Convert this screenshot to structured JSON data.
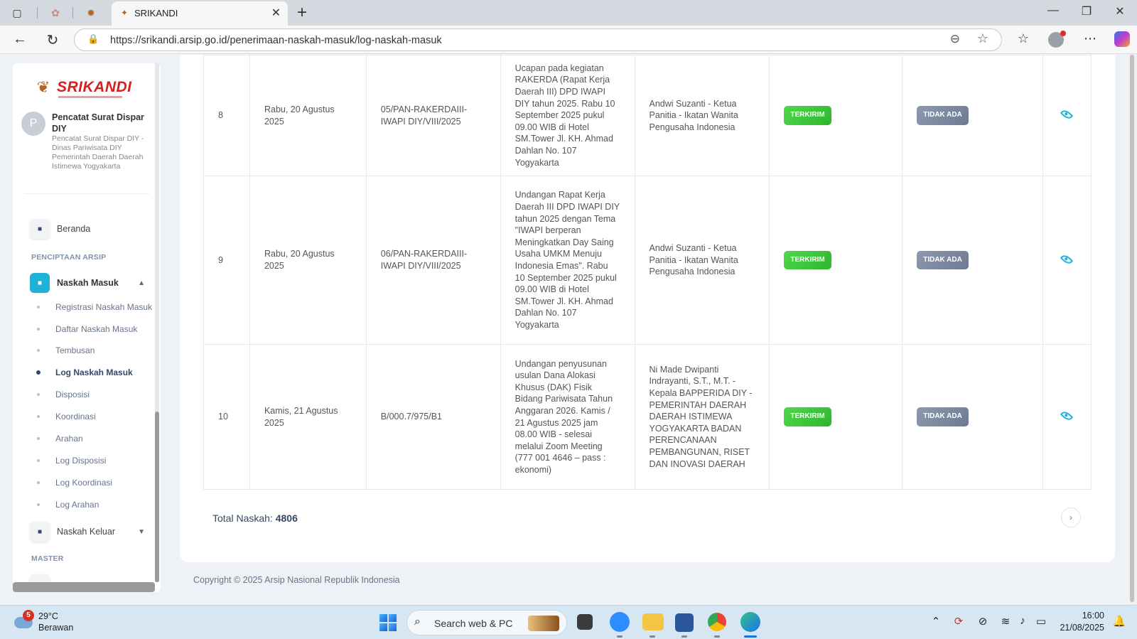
{
  "browser": {
    "tab_title": "SRIKANDI",
    "url": "https://srikandi.arsip.go.id/penerimaan-naskah-masuk/log-naskah-masuk"
  },
  "sidebar": {
    "brand": "SRIKANDI",
    "user": {
      "initial": "P",
      "name": "Pencatat Surat Dispar DIY",
      "description": "Pencatat Surat Dispar DIY - Dinas Pariwisata DIY Pemerintah Daerah Daerah Istimewa Yogyakarta"
    },
    "home": "Beranda",
    "section_penciptaan": "PENCIPTAAN ARSIP",
    "naskah_masuk": "Naskah Masuk",
    "submenu": [
      {
        "label": "Registrasi Naskah Masuk"
      },
      {
        "label": "Daftar Naskah Masuk"
      },
      {
        "label": "Tembusan"
      },
      {
        "label": "Log Naskah Masuk"
      },
      {
        "label": "Disposisi"
      },
      {
        "label": "Koordinasi"
      },
      {
        "label": "Arahan"
      },
      {
        "label": "Log Disposisi"
      },
      {
        "label": "Log Koordinasi"
      },
      {
        "label": "Log Arahan"
      }
    ],
    "naskah_keluar": "Naskah Keluar",
    "section_master": "MASTER"
  },
  "table": {
    "rows": [
      {
        "no": "8",
        "date": "Rabu, 20 Agustus 2025",
        "number": "05/PAN-RAKERDAIII-IWAPI DIY/VIII/2025",
        "subject": "Ucapan pada kegiatan RAKERDA (Rapat Kerja Daerah III) DPD IWAPI DIY tahun 2025. Rabu 10 September 2025 pukul 09.00 WIB di Hotel SM.Tower Jl. KH. Ahmad Dahlan No. 107 Yogyakarta",
        "from": "Andwi Suzanti - Ketua Panitia - Ikatan Wanita Pengusaha Indonesia",
        "status": "TERKIRIM",
        "disposisi": "TIDAK ADA"
      },
      {
        "no": "9",
        "date": "Rabu, 20 Agustus 2025",
        "number": "06/PAN-RAKERDAIII-IWAPI DIY/VIII/2025",
        "subject": "Undangan Rapat Kerja Daerah III DPD IWAPI DIY tahun 2025 dengan Tema \"IWAPI berperan Meningkatkan Day Saing Usaha UMKM Menuju Indonesia Emas\". Rabu 10 September 2025 pukul 09.00 WIB di Hotel SM.Tower Jl. KH. Ahmad Dahlan No. 107 Yogyakarta",
        "from": "Andwi Suzanti - Ketua Panitia - Ikatan Wanita Pengusaha Indonesia",
        "status": "TERKIRIM",
        "disposisi": "TIDAK ADA"
      },
      {
        "no": "10",
        "date": "Kamis, 21 Agustus 2025",
        "number": "B/000.7/975/B1",
        "subject": "Undangan penyusunan usulan Dana Alokasi Khusus (DAK) Fisik Bidang Pariwisata Tahun Anggaran 2026. Kamis / 21 Agustus 2025 jam 08.00 WIB - selesai melalui Zoom Meeting (777 001 4646 – pass : ekonomi)",
        "from": "Ni Made Dwipanti Indrayanti, S.T., M.T. - Kepala BAPPERIDA DIY - PEMERINTAH DAERAH DAERAH ISTIMEWA YOGYAKARTA BADAN PERENCANAAN PEMBANGUNAN, RISET DAN INOVASI DAERAH",
        "status": "TERKIRIM",
        "disposisi": "TIDAK ADA"
      }
    ],
    "total_label": "Total Naskah:",
    "total_value": "4806"
  },
  "footer": "Copyright © 2025 Arsip Nasional Republik Indonesia",
  "taskbar": {
    "weather_badge": "5",
    "temperature": "29°C",
    "condition": "Berawan",
    "search_placeholder": "Search web & PC",
    "time": "16:00",
    "date": "21/08/2025"
  }
}
